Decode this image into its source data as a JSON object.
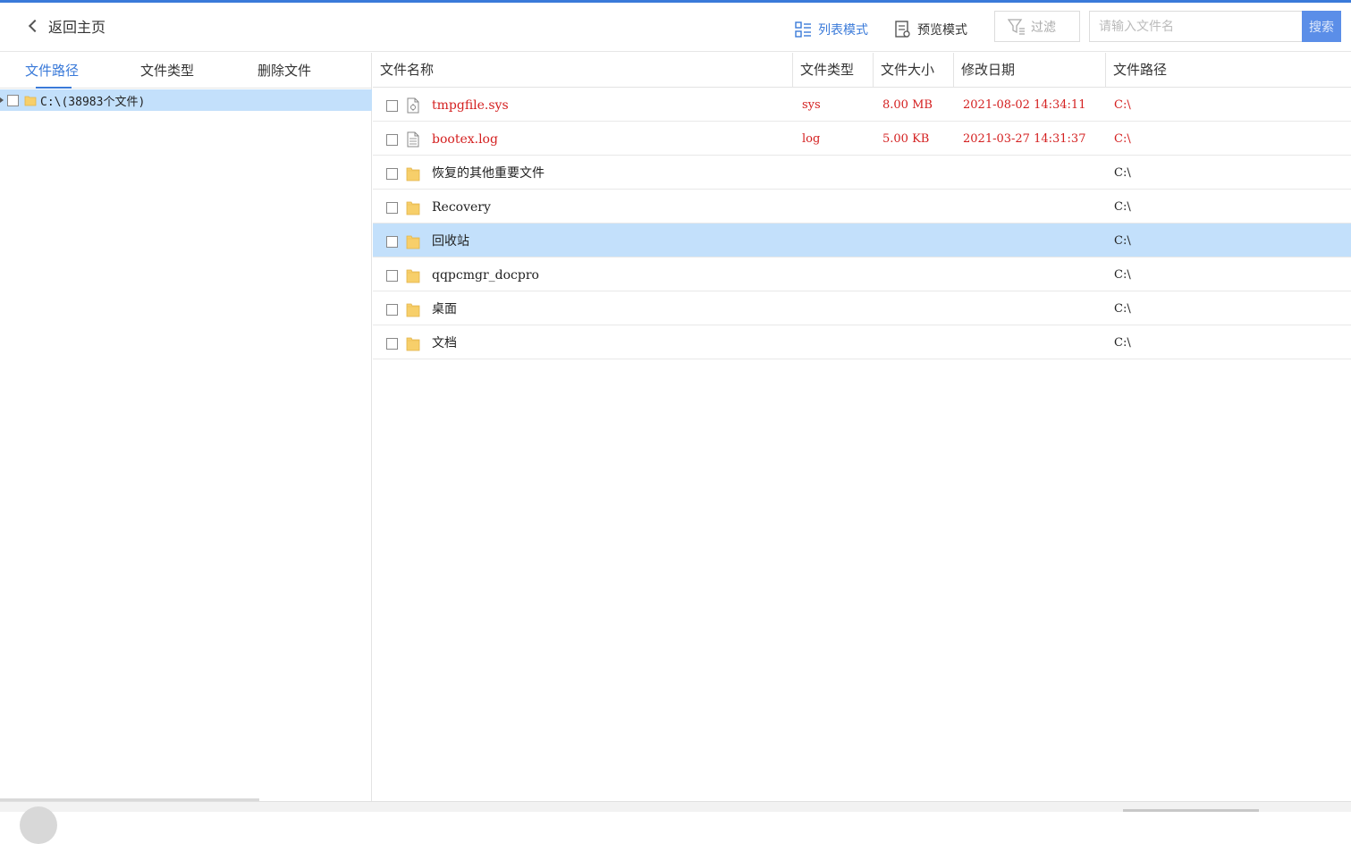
{
  "header": {
    "back_label": "返回主页",
    "list_mode_label": "列表模式",
    "preview_mode_label": "预览模式",
    "filter_label": "过滤",
    "search_placeholder": "请输入文件名",
    "search_value": "",
    "search_button_label": "搜索"
  },
  "sidebar": {
    "tabs": [
      {
        "label": "文件路径",
        "active": true
      },
      {
        "label": "文件类型",
        "active": false
      },
      {
        "label": "删除文件",
        "active": false
      }
    ],
    "tree": [
      {
        "label": "C:\\(38983个文件)",
        "checked": false,
        "selected": true
      }
    ]
  },
  "table": {
    "columns": [
      "文件名称",
      "文件类型",
      "文件大小",
      "修改日期",
      "文件路径"
    ],
    "rows": [
      {
        "name": "tmpgfile.sys",
        "type": "sys",
        "size": "8.00 MB",
        "date": "2021-08-02 14:34:11",
        "path": "C:\\",
        "icon": "system-file-icon",
        "deleted": true,
        "selected": false
      },
      {
        "name": "bootex.log",
        "type": "log",
        "size": "5.00 KB",
        "date": "2021-03-27 14:31:37",
        "path": "C:\\",
        "icon": "text-file-icon",
        "deleted": true,
        "selected": false
      },
      {
        "name": "恢复的其他重要文件",
        "type": "",
        "size": "",
        "date": "",
        "path": "C:\\",
        "icon": "folder-icon",
        "deleted": false,
        "selected": false
      },
      {
        "name": "Recovery",
        "type": "",
        "size": "",
        "date": "",
        "path": "C:\\",
        "icon": "folder-icon",
        "deleted": false,
        "selected": false
      },
      {
        "name": "回收站",
        "type": "",
        "size": "",
        "date": "",
        "path": "C:\\",
        "icon": "folder-icon",
        "deleted": false,
        "selected": true
      },
      {
        "name": "qqpcmgr_docpro",
        "type": "",
        "size": "",
        "date": "",
        "path": "C:\\",
        "icon": "folder-icon",
        "deleted": false,
        "selected": false
      },
      {
        "name": "桌面",
        "type": "",
        "size": "",
        "date": "",
        "path": "C:\\",
        "icon": "folder-icon",
        "deleted": false,
        "selected": false
      },
      {
        "name": "文档",
        "type": "",
        "size": "",
        "date": "",
        "path": "C:\\",
        "icon": "folder-icon",
        "deleted": false,
        "selected": false
      }
    ]
  },
  "colors": {
    "accent": "#3a7ad9",
    "selection": "#c3e0fb",
    "deleted_text": "#d42020",
    "search_button": "#5b8ee8"
  }
}
